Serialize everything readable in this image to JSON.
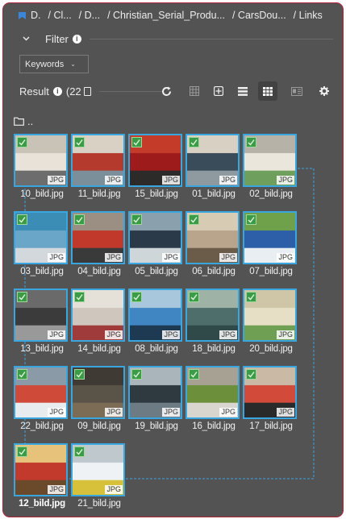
{
  "breadcrumb": {
    "items": [
      "D.",
      "/ Cl...",
      "/ D...",
      "/ Christian_Serial_Produ...",
      "/ CarsDou...",
      "/ Links"
    ]
  },
  "filter": {
    "label": "Filter"
  },
  "keywords": {
    "label": "Keywords"
  },
  "result": {
    "label": "Result",
    "count": "(22"
  },
  "folder": {
    "label": ".."
  },
  "files": [
    {
      "name": "10_bild.jpg",
      "type": "JPG",
      "selected": false
    },
    {
      "name": "11_bild.jpg",
      "type": "JPG",
      "selected": false
    },
    {
      "name": "15_bild.jpg",
      "type": "JPG",
      "selected": false
    },
    {
      "name": "01_bild.jpg",
      "type": "JPG",
      "selected": false
    },
    {
      "name": "02_bild.jpg",
      "type": "JPG",
      "selected": false
    },
    {
      "name": "03_bild.jpg",
      "type": "JPG",
      "selected": false
    },
    {
      "name": "04_bild.jpg",
      "type": "JPG",
      "selected": false
    },
    {
      "name": "05_bild.jpg",
      "type": "JPG",
      "selected": false
    },
    {
      "name": "06_bild.jpg",
      "type": "JPG",
      "selected": false
    },
    {
      "name": "07_bild.jpg",
      "type": "JPG",
      "selected": false
    },
    {
      "name": "13_bild.jpg",
      "type": "JPG",
      "selected": false
    },
    {
      "name": "14_bild.jpg",
      "type": "JPG",
      "selected": false
    },
    {
      "name": "08_bild.jpg",
      "type": "JPG",
      "selected": false
    },
    {
      "name": "18_bild.jpg",
      "type": "JPG",
      "selected": false
    },
    {
      "name": "20_bild.jpg",
      "type": "JPG",
      "selected": false
    },
    {
      "name": "22_bild.jpg",
      "type": "JPG",
      "selected": false
    },
    {
      "name": "09_bild.jpg",
      "type": "JPG",
      "selected": false
    },
    {
      "name": "19_bild.jpg",
      "type": "JPG",
      "selected": false
    },
    {
      "name": "16_bild.jpg",
      "type": "JPG",
      "selected": false
    },
    {
      "name": "17_bild.jpg",
      "type": "JPG",
      "selected": false
    },
    {
      "name": "12_bild.jpg",
      "type": "JPG",
      "selected": true
    },
    {
      "name": "21_bild.jpg",
      "type": "JPG",
      "selected": false
    }
  ],
  "colors": {
    "panel": "#535353",
    "border": "#b0233a",
    "tile_border": "#3aa6e0",
    "check": "#3b9b47"
  },
  "toolbar_icons": [
    "refresh-icon",
    "grid-small-icon",
    "grid-plus-icon",
    "list-icon",
    "grid-large-icon",
    "card-view-icon",
    "settings-icon"
  ]
}
